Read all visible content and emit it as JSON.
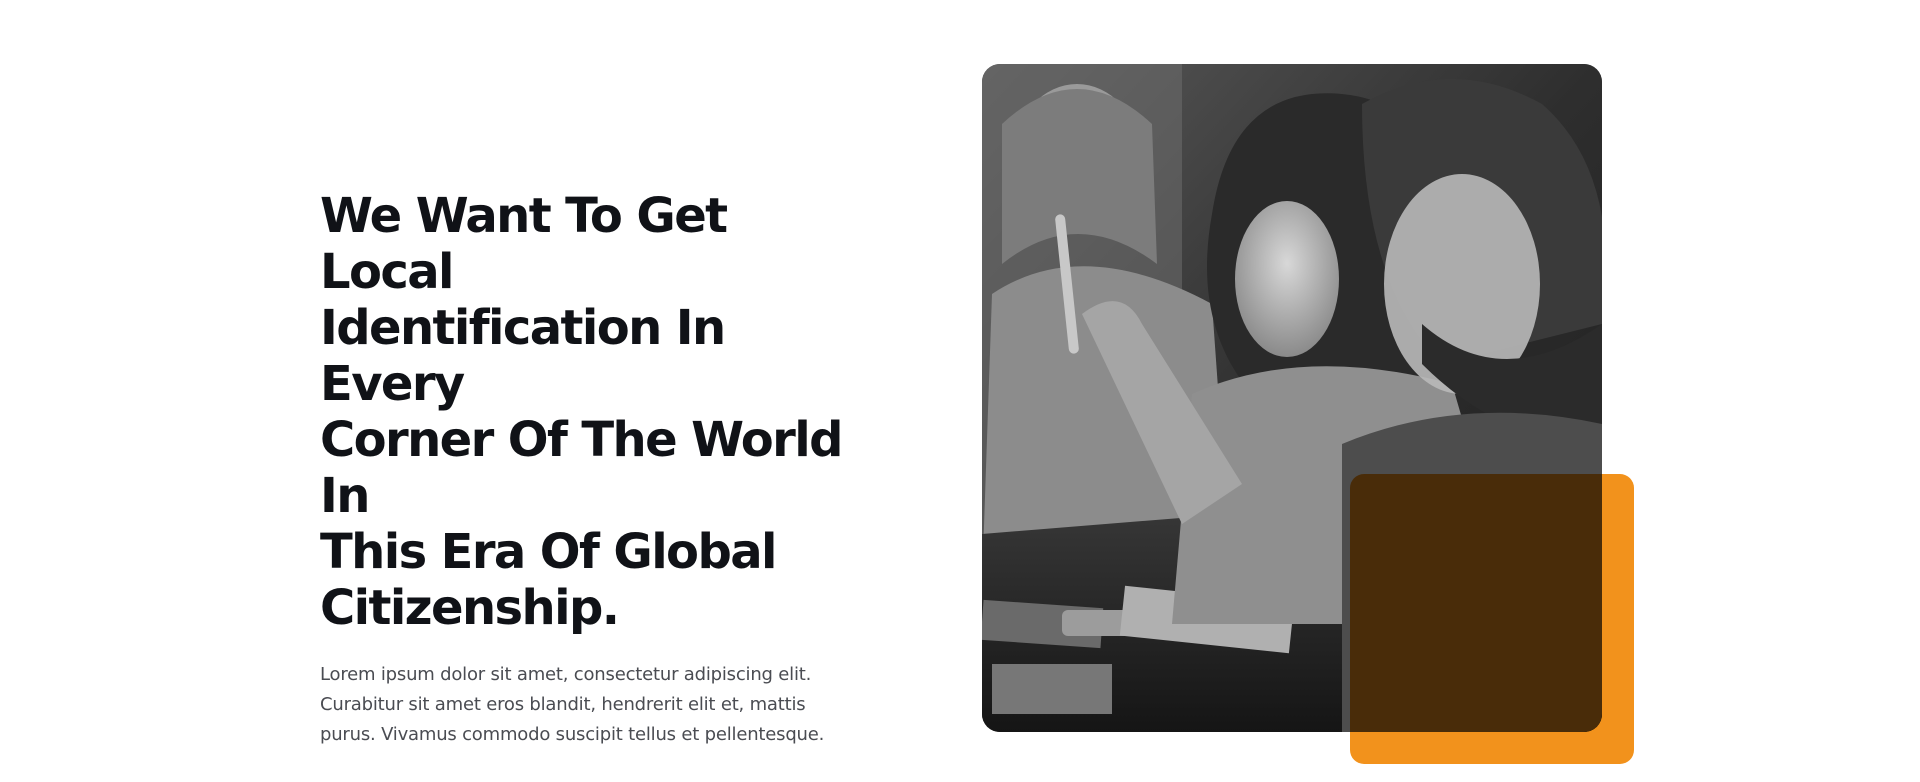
{
  "hero": {
    "heading": "We Want To Get Local\nIdentification In Every\nCorner Of The World In\nThis Era Of Global\nCitizenship.",
    "body": "Lorem ipsum dolor sit amet, consectetur adipiscing elit. Curabitur sit amet eros blandit, hendrerit elit et, mattis purus. Vivamus commodo suscipit tellus et pellentesque."
  },
  "image": {
    "description_icon": "photo-icon",
    "accent_color": "#F28C0F"
  },
  "colors": {
    "heading": "#101217",
    "body": "#4A4C52",
    "background": "#FFFFFF",
    "accent": "#F28C0F"
  }
}
